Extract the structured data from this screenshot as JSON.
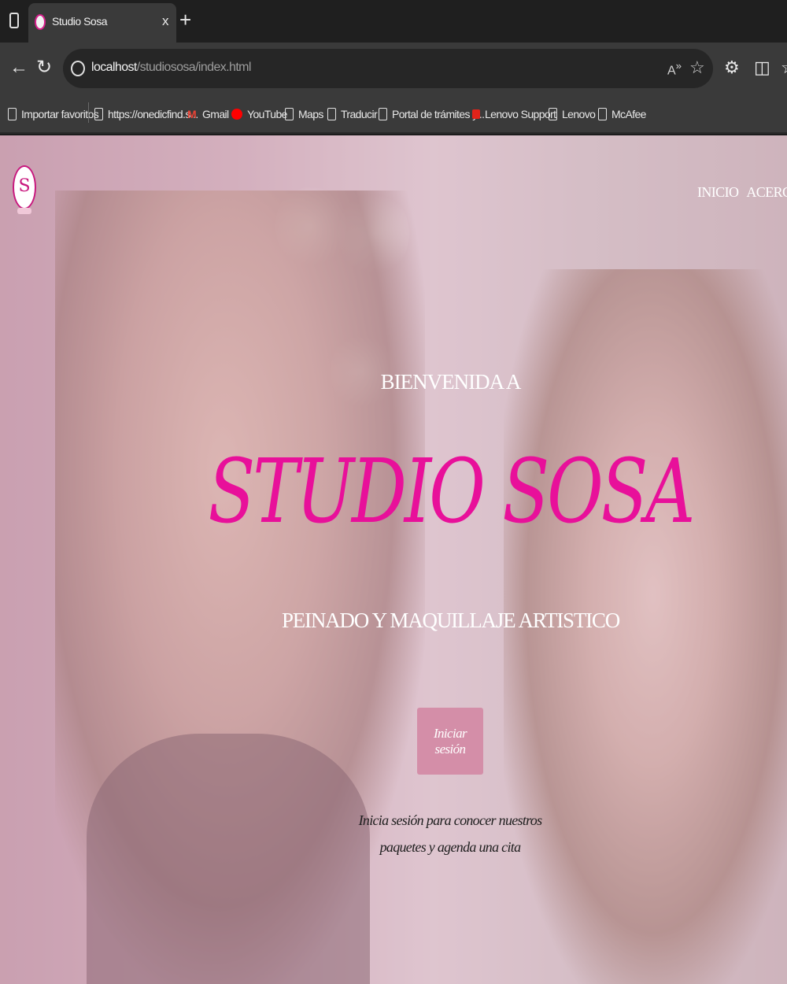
{
  "browser": {
    "tab": {
      "title": "Studio Sosa",
      "close_label": "x"
    },
    "new_tab_label": "+",
    "url": {
      "host": "localhost",
      "path": "/studiososa/index.html"
    },
    "bookmarks": [
      {
        "label": "Importar favoritos",
        "icon": "import-icon"
      },
      {
        "label": "https://onedicfind.s...",
        "icon": "page-icon"
      },
      {
        "label": "Gmail",
        "icon": "gmail-icon"
      },
      {
        "label": "YouTube",
        "icon": "youtube-icon"
      },
      {
        "label": "Maps",
        "icon": "page-icon"
      },
      {
        "label": "Traducir",
        "icon": "page-icon"
      },
      {
        "label": "Portal de trámites y...",
        "icon": "page-icon"
      },
      {
        "label": "Lenovo Support",
        "icon": "lenovo-icon"
      },
      {
        "label": "Lenovo",
        "icon": "page-icon"
      },
      {
        "label": "McAfee",
        "icon": "page-icon"
      }
    ]
  },
  "site": {
    "logo_letter": "S",
    "nav": {
      "inicio": "INICIO",
      "acerca": "ACERCA D"
    },
    "hero": {
      "welcome": "BIENVENIDA A",
      "title": "STUDIO SOSA",
      "tagline": "PEINADO Y MAQUILLAJE ARTISTICO",
      "login_button": "Iniciar sesión",
      "login_note_line1": "Inicia sesión para conocer nuestros",
      "login_note_line2": "paquetes y agenda una cita"
    }
  },
  "colors": {
    "accent": "#e8109a",
    "button": "#d48ea8",
    "browser_bg": "#3a3a3a"
  }
}
